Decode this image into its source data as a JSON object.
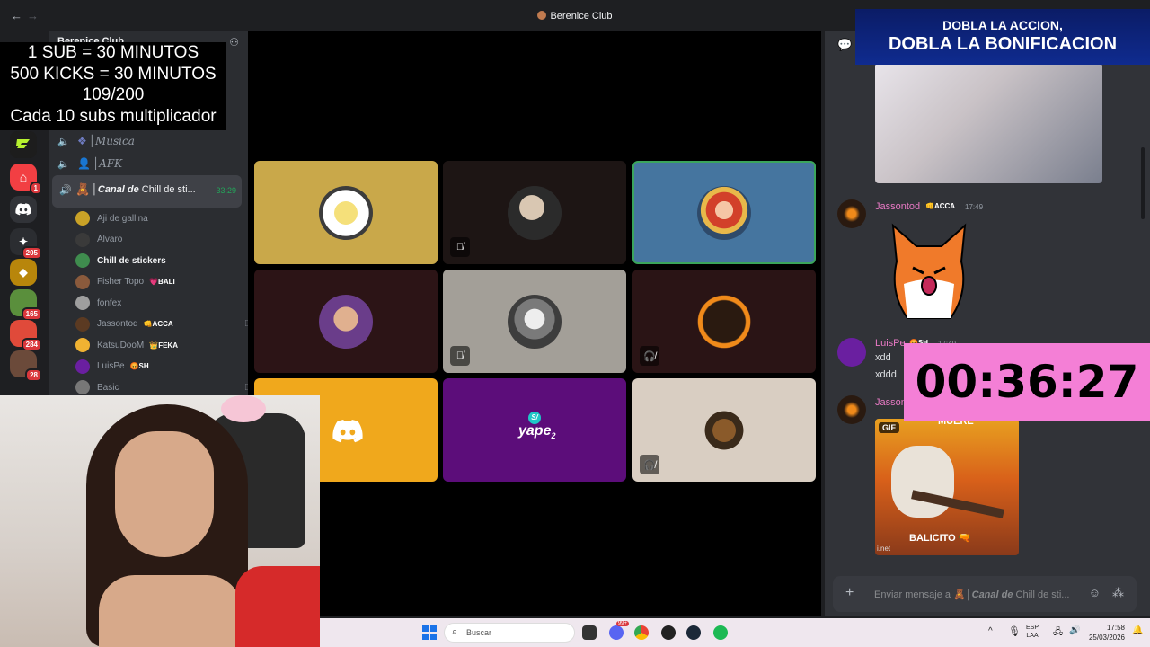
{
  "window": {
    "title": "Berenice Club",
    "back_glyph": "←",
    "forward_glyph": "→"
  },
  "server_rail": {
    "badges": [
      "1",
      "205",
      "165",
      "284",
      "28"
    ]
  },
  "server": {
    "name": "Berenice Club"
  },
  "overlay": {
    "lines": [
      "1 SUB     = 30 MINUTOS",
      "500 KICKS = 30 MINUTOS",
      "109/200",
      "Cada 10 subs multiplicador"
    ]
  },
  "channels": {
    "musica": "│Musica",
    "afk": "│AFK",
    "active_prefix": "│",
    "active_italic": "Canal de",
    "active_rest": "Chill de sti...",
    "active_time": "33:29"
  },
  "members": [
    {
      "name": "Aji de gallina",
      "tag": "",
      "color": "#c9a227"
    },
    {
      "name": "Alvaro",
      "tag": "",
      "color": "#3a3a3a"
    },
    {
      "name": "Chill de stickers",
      "tag": "",
      "color": "#3f8c4e"
    },
    {
      "name": "Fisher Topo",
      "tag": "💗BALI",
      "color": "#8a5a3c"
    },
    {
      "name": "fonfex",
      "tag": "",
      "color": "#9e9e9e"
    },
    {
      "name": "Jassontod",
      "tag": "👊ACCA",
      "color": "#5b3a22"
    },
    {
      "name": "KatsuDooM",
      "tag": "👑FEKA",
      "color": "#f0b232"
    },
    {
      "name": "LuisPe",
      "tag": "😡SH",
      "color": "#6a1fa0"
    },
    {
      "name": "Basic",
      "tag": "",
      "color": "#777"
    }
  ],
  "banner": {
    "line1": "DOBLA LA ACCION,",
    "line2": "DOBLA LA BONIFICACION"
  },
  "timer": "00:36:27",
  "chat": {
    "messages": [
      {
        "user": "Jassontod",
        "tag": "👊ACCA",
        "time": "17:49",
        "color": "#e879c4"
      },
      {
        "user": "LuisPe",
        "tag": "😡SH",
        "time": "17:49",
        "color": "#e879c4",
        "lines": [
          "xdd",
          "xddd"
        ]
      },
      {
        "user": "Jasson",
        "tag": "",
        "time": "",
        "color": "#e879c4"
      }
    ],
    "gif_label": "GIF",
    "gif_top_text": "MUERE",
    "gif_caption": "BALICITO 🔫",
    "gif_url_fragment": "i.net",
    "composer_prefix": "Enviar mensaje a 🧸│",
    "composer_italic": "Canal de",
    "composer_rest": "Chill de sti..."
  },
  "taskbar": {
    "search_placeholder": "Buscar",
    "lang_top": "ESP",
    "lang_bottom": "LAA",
    "time": "17:58",
    "date": "25/03/2026",
    "notif_count": "99+"
  }
}
